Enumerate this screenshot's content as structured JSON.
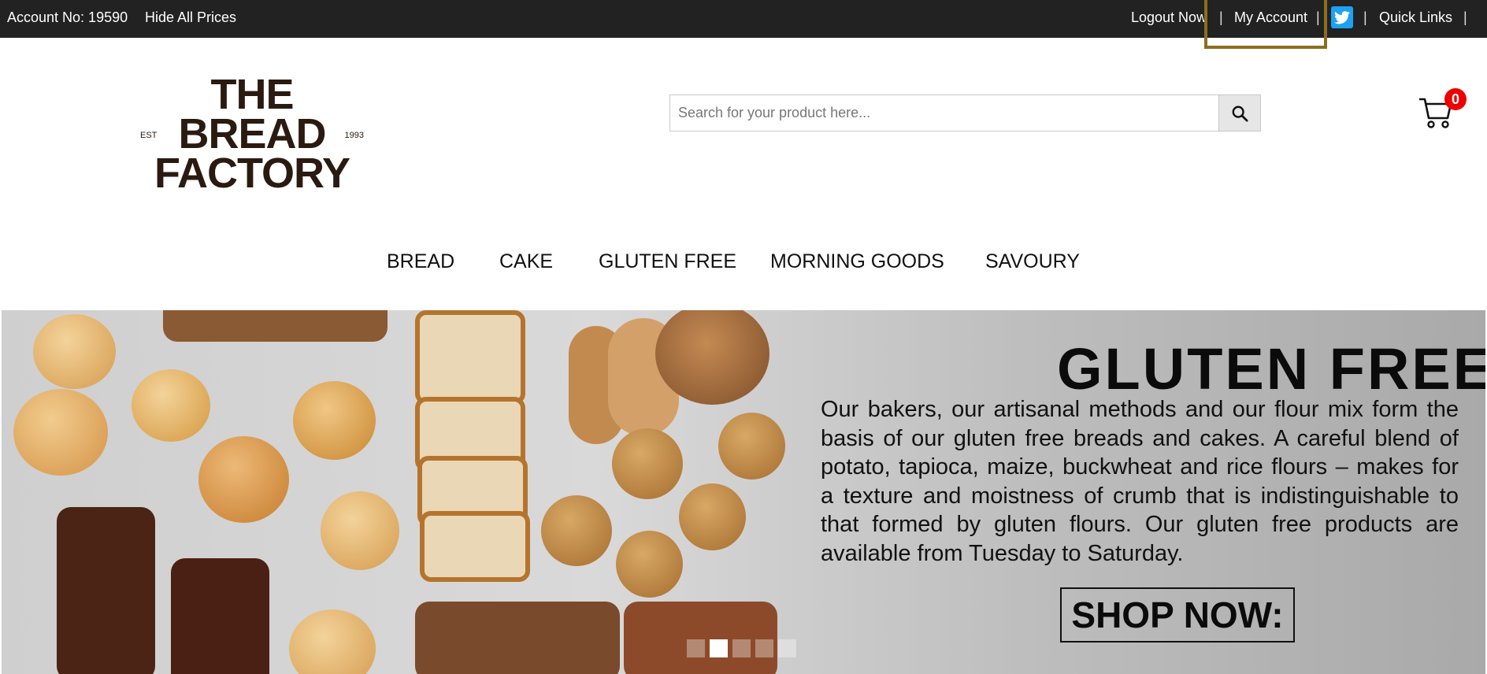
{
  "topbar": {
    "account_no": "Account No: 19590",
    "hide_prices": "Hide All Prices",
    "logout": "Logout Now",
    "my_account": "My Account",
    "quick_links": "Quick Links",
    "separator": "|",
    "twitter_icon": "twitter-icon"
  },
  "logo": {
    "line1": "THE",
    "line2": "BREAD",
    "line3": "FACTORY",
    "est": "EST",
    "year": "1993"
  },
  "search": {
    "placeholder": "Search for your product here...",
    "icon": "search-icon"
  },
  "cart": {
    "count": "0",
    "icon": "cart-icon"
  },
  "nav": {
    "items": [
      "BREAD",
      "CAKE",
      "GLUTEN FREE",
      "MORNING GOODS",
      "SAVOURY"
    ]
  },
  "hero": {
    "title": "GLUTEN FREE",
    "body": "Our bakers, our artisanal methods and our flour mix form the basis of our gluten free breads and cakes. A careful blend of potato, tapioca, maize, buckwheat and rice flours – makes for a texture and moistness of crumb that is indistinguishable to that formed by gluten flours. Our gluten free products are available from Tuesday to Saturday.",
    "cta": "SHOP NOW:",
    "slides_total": 5,
    "active_slide": 2
  },
  "colors": {
    "topbar_bg": "#222222",
    "focus_outline": "#8b6f1f",
    "badge": "#ee0000",
    "twitter": "#1da1f2"
  }
}
